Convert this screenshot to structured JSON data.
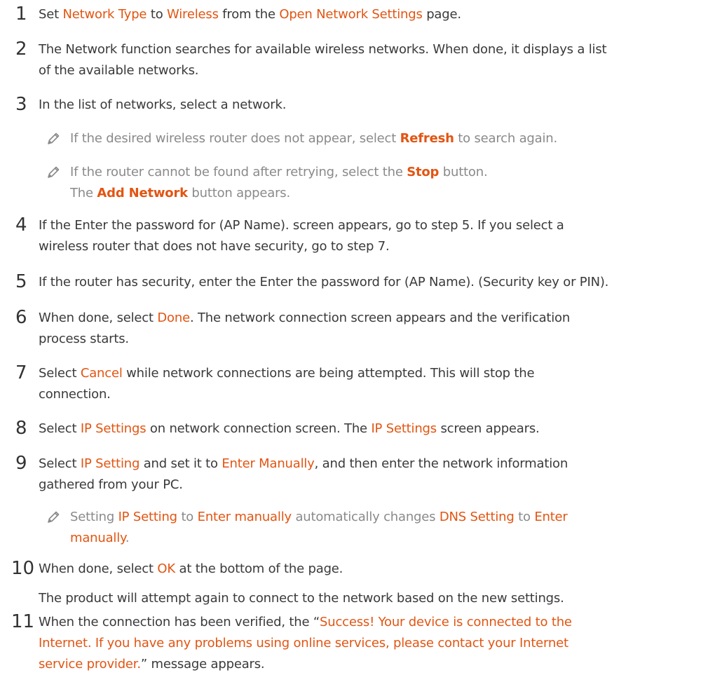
{
  "steps": [
    {
      "number": "1",
      "s": [
        "Set ",
        "Network Type",
        " to ",
        "Wireless",
        " from the ",
        "Open Network Settings",
        " page."
      ]
    },
    {
      "number": "2",
      "line1": "The Network function searches for available wireless networks. When done, it displays a list",
      "line2": "of the available networks."
    },
    {
      "number": "3",
      "text": "In the list of networks, select a network.",
      "notes": [
        {
          "s": [
            "If the desired wireless router does not appear, select ",
            "Refresh",
            " to search again."
          ]
        },
        {
          "s": [
            "If the router cannot be found after retrying, select the ",
            "Stop",
            " button."
          ],
          "s2": [
            "The ",
            "Add Network",
            " button appears."
          ]
        }
      ]
    },
    {
      "number": "4",
      "line1": "If the Enter the password for (AP Name). screen appears, go to step 5. If you select a",
      "line2": "wireless router that does not have security, go to step 7."
    },
    {
      "number": "5",
      "text": "If the router has security, enter the Enter the password for (AP Name). (Security key or PIN)."
    },
    {
      "number": "6",
      "s": [
        "When done, select ",
        "Done",
        ". The network connection screen appears and the verification"
      ],
      "line2": "process starts."
    },
    {
      "number": "7",
      "s": [
        "Select ",
        "Cancel",
        " while network connections are being attempted. This will stop the"
      ],
      "line2": "connection."
    },
    {
      "number": "8",
      "s": [
        "Select ",
        "IP Settings",
        " on network connection screen. The ",
        "IP Settings",
        " screen appears."
      ]
    },
    {
      "number": "9",
      "s": [
        "Select ",
        "IP Setting",
        " and set it to ",
        "Enter Manually",
        ", and then enter the network information"
      ],
      "line2": "gathered from your PC.",
      "note": {
        "s": [
          "Setting ",
          "IP Setting",
          " to ",
          "Enter manually",
          " automatically changes ",
          "DNS Setting",
          " to ",
          "Enter"
        ],
        "s2": [
          "manually",
          "."
        ]
      }
    },
    {
      "number": "10",
      "s": [
        "When done, select ",
        "OK",
        " at the bottom of the page."
      ],
      "line2": "The product will attempt again to connect to the network based on the new settings."
    },
    {
      "number": "11",
      "s": [
        "When the connection has been verified, the “",
        "Success! Your device is connected to the"
      ],
      "line2": "Internet. If you have any problems using online services, please contact your Internet",
      "s3": [
        "service provider.",
        "” message appears."
      ]
    }
  ],
  "icons": {
    "note": "pencil-icon"
  },
  "colors": {
    "accent": "#e25512",
    "note_text": "#8a8a8a",
    "body_text": "#3a3a3a"
  }
}
